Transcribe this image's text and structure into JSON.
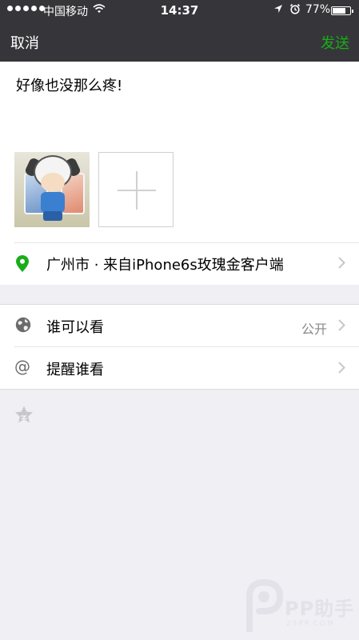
{
  "status_bar": {
    "carrier": "中国移动",
    "time": "14:37",
    "battery_percent_text": "77%",
    "battery_level": 0.77,
    "icons": [
      "signal-dots",
      "wifi-icon",
      "location-arrow-icon",
      "alarm-icon",
      "battery-icon"
    ]
  },
  "nav": {
    "cancel_label": "取消",
    "send_label": "发送",
    "send_color": "#1aad19"
  },
  "compose": {
    "text": "好像也没那么疼!",
    "photo_count": 1
  },
  "location": {
    "label": "广州市 · 来自iPhone6s玫瑰金客户端",
    "icon": "location-pin-icon",
    "icon_color": "#1aad19"
  },
  "options": {
    "visibility": {
      "label": "谁可以看",
      "value": "公开",
      "icon": "globe-icon"
    },
    "mention": {
      "label": "提醒谁看",
      "icon": "at-icon"
    }
  },
  "footer": {
    "icon": "star-icon"
  },
  "watermark": {
    "brand": "PP助手",
    "site": "25PP.COM"
  }
}
